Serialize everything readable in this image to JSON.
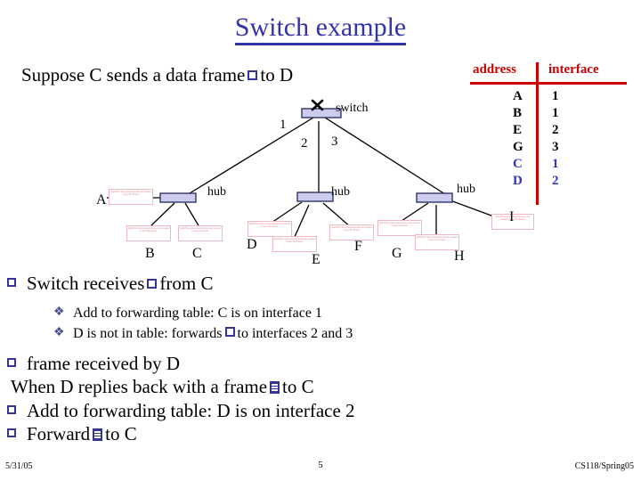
{
  "slide": {
    "title": "Switch example",
    "lead_before": "Suppose C sends a data frame",
    "lead_after": "to D"
  },
  "forwarding_table": {
    "header_address": "address",
    "header_interface": "interface",
    "rows": [
      {
        "address": "A",
        "interface": "1",
        "state": "old"
      },
      {
        "address": "B",
        "interface": "1",
        "state": "old"
      },
      {
        "address": "E",
        "interface": "2",
        "state": "old"
      },
      {
        "address": "G",
        "interface": "3",
        "state": "old"
      },
      {
        "address": "C",
        "interface": "1",
        "state": "new"
      },
      {
        "address": "D",
        "interface": "2",
        "state": "new"
      }
    ]
  },
  "diagram": {
    "switch_label": "switch",
    "hub_labels": [
      "hub",
      "hub",
      "hub"
    ],
    "port_labels": [
      "1",
      "2",
      "3"
    ],
    "host_labels": [
      "A",
      "B",
      "C",
      "D",
      "E",
      "F",
      "G",
      "H",
      "I"
    ],
    "placeholder_text": "QuickTime and a decompressor are needed to see this picture.",
    "device_fill": "#ccccee",
    "device_stroke": "#333366"
  },
  "bullets": {
    "l1_a_before": "Switch receives",
    "l1_a_after": "from C",
    "l2_a": "Add to forwarding table: C is on interface 1",
    "l2_b_before": "D is not in table: forwards",
    "l2_b_after": "to interfaces 2 and 3",
    "l1_b": "frame received by D",
    "plain_before": "When D replies back with a frame",
    "plain_after": "to C",
    "l1_c": "Add to forwarding table: D is on interface 2",
    "l1_d_before": "Forward",
    "l1_d_after": "to C"
  },
  "footer": {
    "date": "5/31/05",
    "page": "5",
    "course": "CS118/Spring05"
  }
}
